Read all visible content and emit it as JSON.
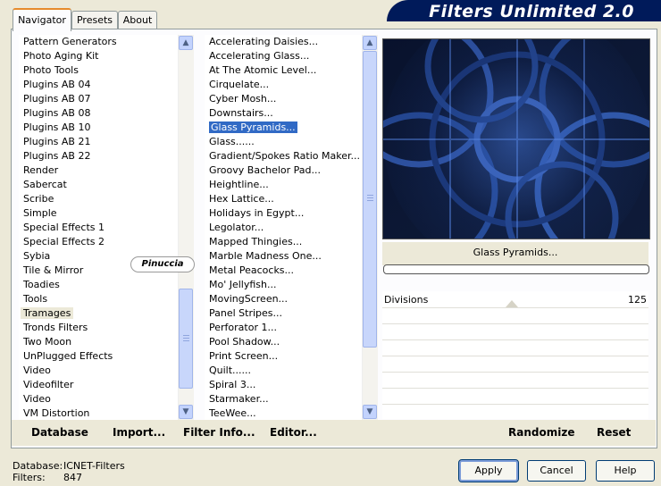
{
  "app": {
    "title": "Filters Unlimited 2.0"
  },
  "tabs": [
    {
      "label": "Navigator",
      "active": true
    },
    {
      "label": "Presets",
      "active": false
    },
    {
      "label": "About",
      "active": false
    }
  ],
  "categories": {
    "items": [
      "Pattern Generators",
      "Photo Aging Kit",
      "Photo Tools",
      "Plugins AB 04",
      "Plugins AB 07",
      "Plugins AB 08",
      "Plugins AB 10",
      "Plugins AB 21",
      "Plugins AB 22",
      "Render",
      "Sabercat",
      "Scribe",
      "Simple",
      "Special Effects 1",
      "Special Effects 2",
      "Sybia",
      "Tile & Mirror",
      "Toadies",
      "Tools",
      "Tramages",
      "Tronds Filters",
      "Two Moon",
      "UnPlugged Effects",
      "Video",
      "Videofilter",
      "Video",
      "VM Distortion"
    ],
    "selected": "Tramages"
  },
  "filters": {
    "items": [
      "Accelerating Daisies...",
      "Accelerating Glass...",
      "At The Atomic Level...",
      "Cirquelate...",
      "Cyber Mosh...",
      "Downstairs...",
      "Glass Pyramids...",
      "Glass......",
      "Gradient/Spokes Ratio Maker...",
      "Groovy Bachelor Pad...",
      "Heightline...",
      "Hex Lattice...",
      "Holidays in Egypt...",
      "Legolator...",
      "Mapped Thingies...",
      "Marble Madness One...",
      "Metal Peacocks...",
      "Mo' Jellyfish...",
      "MovingScreen...",
      "Panel Stripes...",
      "Perforator 1...",
      "Pool Shadow...",
      "Print Screen...",
      "Quilt......",
      "Spiral 3...",
      "Starmaker...",
      "TeeWee..."
    ],
    "selected": "Glass Pyramids..."
  },
  "watermark": "Pinuccia",
  "preview": {
    "filter_name": "Glass Pyramids..."
  },
  "params": [
    {
      "label": "Divisions",
      "value": "125"
    }
  ],
  "toolbar": {
    "database": "Database",
    "import": "Import...",
    "filter_info": "Filter Info...",
    "editor": "Editor...",
    "randomize": "Randomize",
    "reset": "Reset"
  },
  "status": {
    "database_label": "Database:",
    "database_value": "ICNET-Filters",
    "filters_label": "Filters:",
    "filters_value": "847"
  },
  "buttons": {
    "apply": "Apply",
    "cancel": "Cancel",
    "help": "Help"
  }
}
